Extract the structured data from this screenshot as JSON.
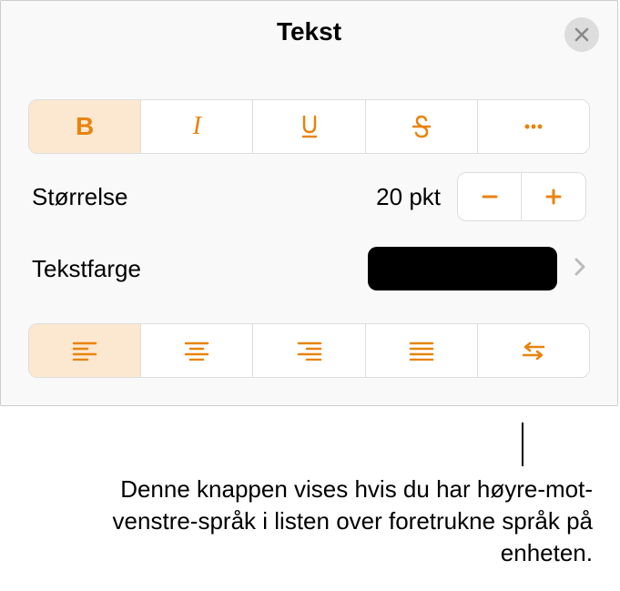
{
  "header": {
    "title": "Tekst"
  },
  "styles": {
    "bold": "B",
    "italic": "I"
  },
  "size": {
    "label": "Størrelse",
    "value": "20 pkt"
  },
  "color": {
    "label": "Tekstfarge",
    "value": "#000000"
  },
  "accentColor": "#e8830d",
  "callout": {
    "text": "Denne knappen vises hvis du har høyre-mot-venstre-språk i listen over foretrukne språk på enheten."
  }
}
